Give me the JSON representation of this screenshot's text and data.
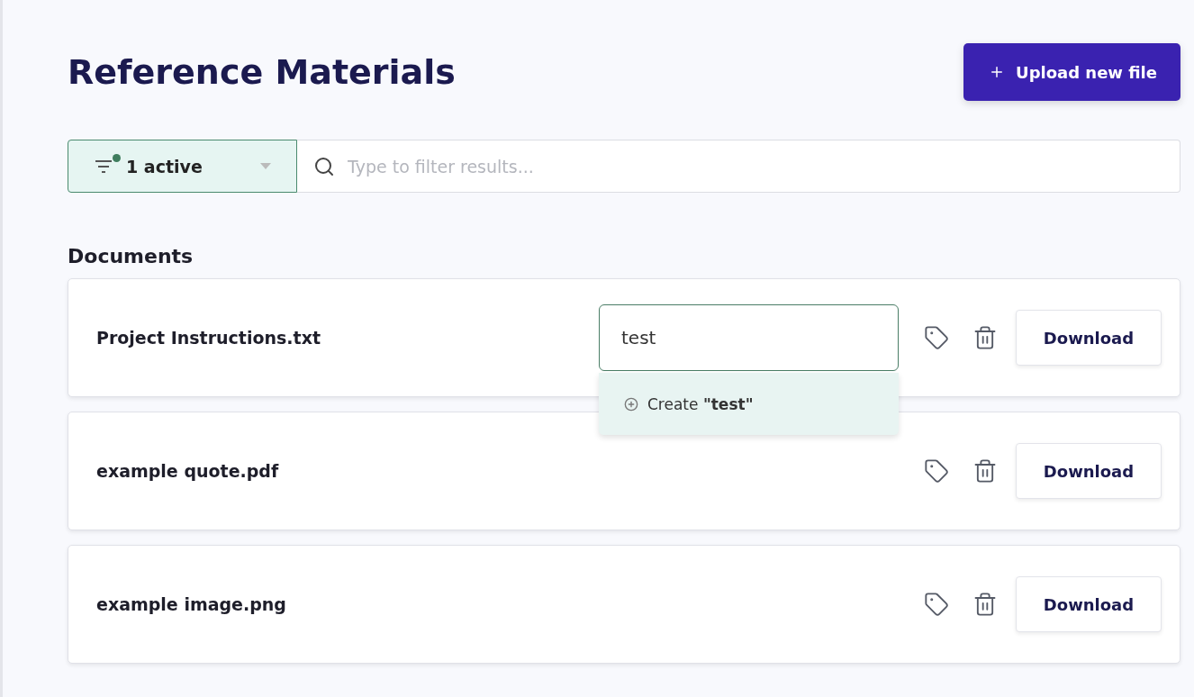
{
  "title": "Reference Materials",
  "upload_button": {
    "label": "Upload new file"
  },
  "filter": {
    "label": "1 active",
    "active": true
  },
  "search": {
    "placeholder": "Type to filter results..."
  },
  "section_title": "Documents",
  "documents": [
    {
      "name": "Project Instructions.txt",
      "tag_input": {
        "value": "test",
        "suggestion": "Create **\"test\"**"
      },
      "download": "Download"
    },
    {
      "name": "example quote.pdf",
      "download": "Download"
    },
    {
      "name": "example image.png",
      "download": "Download"
    }
  ]
}
